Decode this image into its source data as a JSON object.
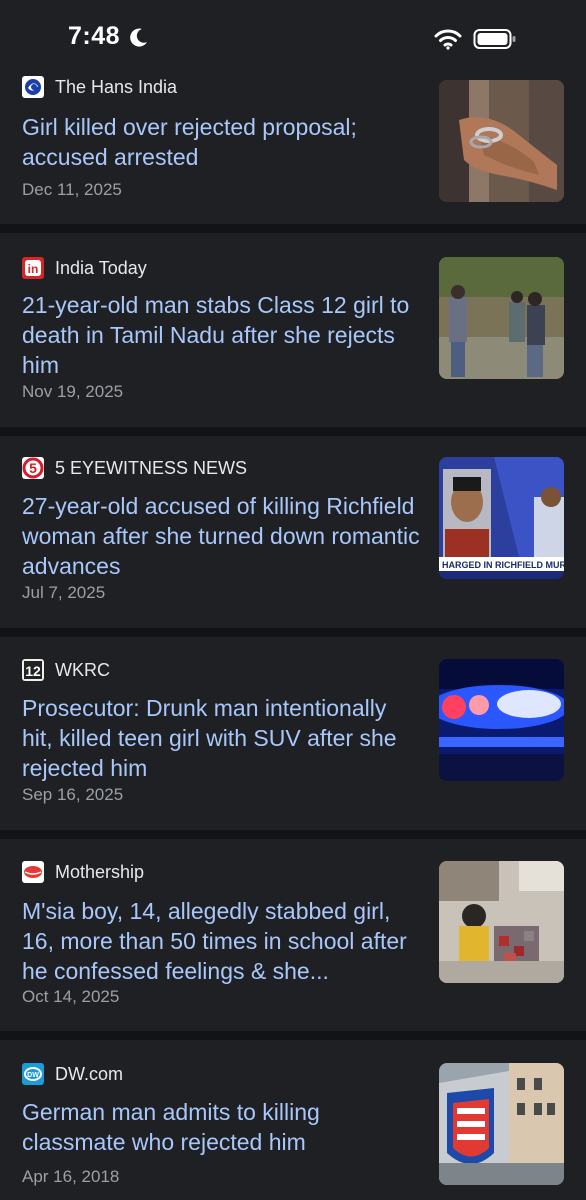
{
  "status_bar": {
    "time": "7:48",
    "icons": [
      "moon-icon",
      "wifi-icon",
      "battery-icon"
    ]
  },
  "articles": [
    {
      "source": "The Hans India",
      "favicon": "hans-india-logo-icon",
      "headline": "Girl killed over rejected proposal; accused arrested",
      "date": "Dec 11, 2025",
      "thumbnail": "handcuffed-hands-photo"
    },
    {
      "source": "India Today",
      "favicon": "india-today-logo-icon",
      "headline": "21-year-old man stabs Class 12 girl to death in Tamil Nadu after she rejects him",
      "date": "Nov 19, 2025",
      "thumbnail": "cctv-street-photo"
    },
    {
      "source": "5 EYEWITNESS NEWS",
      "favicon": "eyewitness-news-logo-icon",
      "headline": "27-year-old accused of killing Richfield woman after she turned down romantic advances",
      "date": "Jul 7, 2025",
      "thumbnail": "news-broadcast-photo",
      "thumbnail_caption": "HARGED IN RICHFIELD MURDER"
    },
    {
      "source": "WKRC",
      "favicon": "wkrc-logo-icon",
      "headline": "Prosecutor: Drunk man intentionally hit, killed teen girl with SUV after she rejected him",
      "date": "Sep 16, 2025",
      "thumbnail": "police-lights-photo"
    },
    {
      "source": "Mothership",
      "favicon": "mothership-logo-icon",
      "headline": "M'sia boy, 14, allegedly stabbed girl, 16, more than 50 times in school after he confessed feelings & she...",
      "date": "Oct 14, 2025",
      "thumbnail": "school-scene-blurred-photo"
    },
    {
      "source": "DW.com",
      "favicon": "dw-logo-icon",
      "headline": "German man admits to killing classmate who rejected him",
      "date": "Apr 16, 2018",
      "thumbnail": "thuringia-coat-of-arms-photo"
    }
  ],
  "colors": {
    "background": "#1f2024",
    "divider": "#121316",
    "headline": "#a8c7fa",
    "source": "#e8e8ea",
    "date": "#9aa0a6"
  }
}
